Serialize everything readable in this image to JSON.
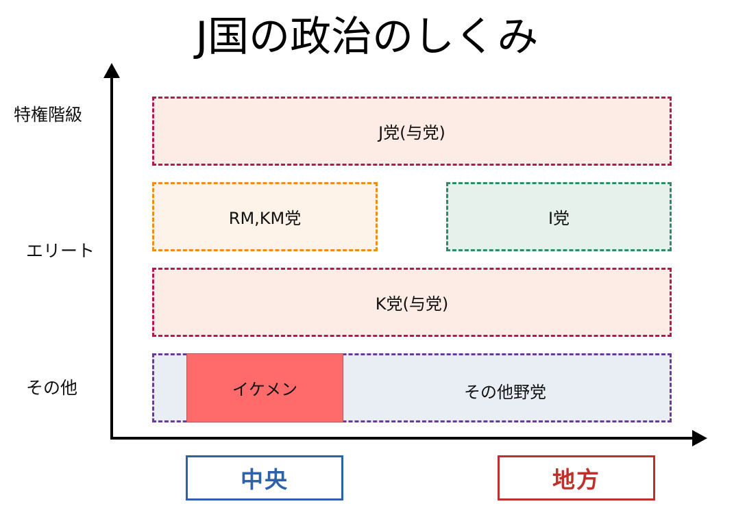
{
  "title": "J国の政治のしくみ",
  "y_axis_labels": {
    "top": "特権階級",
    "middle": "エリート",
    "bottom": "その他"
  },
  "boxes": {
    "j_party": {
      "label": "J党(与党)",
      "border_color": "#b5184f",
      "fill_color": "#fdebe5"
    },
    "rm_km_party": {
      "label": "RM,KM党",
      "border_color": "#f08c1e",
      "fill_color": "#fef3e8"
    },
    "i_party": {
      "label": "I党",
      "border_color": "#2e8b6a",
      "fill_color": "#e7f1ec"
    },
    "k_party": {
      "label": "K党(与党)",
      "border_color": "#b5184f",
      "fill_color": "#fdebe5"
    },
    "other_opposition": {
      "label": "その他野党",
      "border_color": "#6b3a96",
      "fill_color": "#e9eef5"
    },
    "ikemen": {
      "label": "イケメン",
      "fill_color": "#ff6b6b"
    }
  },
  "arrow_color": "#ff0000",
  "axis_color": "#000000",
  "regions": {
    "central": {
      "label": "中央",
      "color": "#2e62a8"
    },
    "local": {
      "label": "地方",
      "color": "#c0302a"
    }
  }
}
